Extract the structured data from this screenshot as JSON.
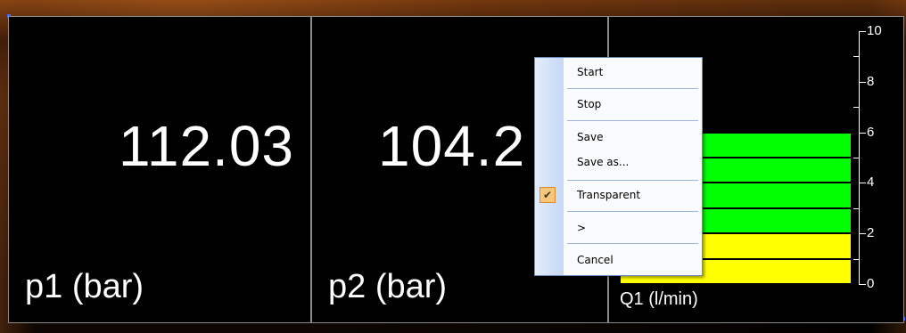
{
  "panels": [
    {
      "value": "112.03",
      "label": "p1 (bar)"
    },
    {
      "value": "104.2",
      "label": "p2 (bar)"
    },
    {
      "label": "Q1 (l/min)"
    }
  ],
  "gauge": {
    "scale_min": 0,
    "scale_max": 10,
    "tick_labels": [
      "10",
      "8",
      "6",
      "4",
      "2",
      "0"
    ],
    "segments": [
      {
        "from": 0,
        "to": 1,
        "color": "#ffff00"
      },
      {
        "from": 1,
        "to": 2,
        "color": "#ffff00"
      },
      {
        "from": 2,
        "to": 3,
        "color": "#00ff00"
      },
      {
        "from": 3,
        "to": 4,
        "color": "#00ff00"
      },
      {
        "from": 4,
        "to": 5,
        "color": "#00ff00"
      },
      {
        "from": 5,
        "to": 6,
        "color": "#00ff00"
      }
    ]
  },
  "context_menu": {
    "items": [
      {
        "label": "Start",
        "enabled": false
      },
      {
        "label": "Stop",
        "enabled": true
      },
      {
        "label": "Save",
        "enabled": false
      },
      {
        "label": "Save as...",
        "enabled": false
      },
      {
        "label": "Transparent",
        "enabled": true,
        "checked": true
      },
      {
        "label": ">",
        "enabled": true
      },
      {
        "label": "Cancel",
        "enabled": true
      }
    ]
  },
  "colors": {
    "accent_check": "#f9c77a",
    "menu_border": "#6a8cc0",
    "bar_green": "#00ff00",
    "bar_yellow": "#ffff00"
  }
}
